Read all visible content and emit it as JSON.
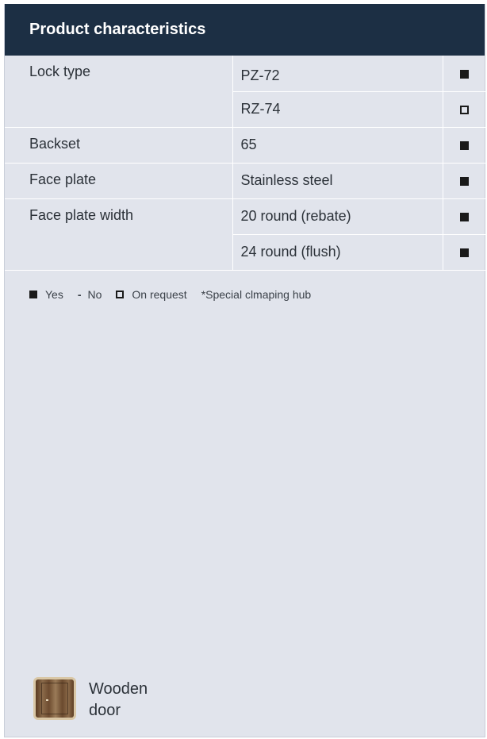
{
  "header": {
    "title": "Product characteristics"
  },
  "rows": [
    {
      "label": "Lock type",
      "value": "PZ-72",
      "symbol": "filled"
    },
    {
      "label": "",
      "value": "RZ-74",
      "symbol": "open"
    },
    {
      "label": "Backset",
      "value": "65",
      "symbol": "filled"
    },
    {
      "label": "Face plate",
      "value": "Stainless steel",
      "symbol": "filled"
    },
    {
      "label": "Face plate width",
      "value": "20 round (rebate)",
      "symbol": "filled"
    },
    {
      "label": "",
      "value": "24 round (flush)",
      "symbol": "filled"
    }
  ],
  "legend": {
    "yes": "Yes",
    "no_symbol": "-",
    "no": "No",
    "on_request": "On request",
    "special": "*Special clmaping hub"
  },
  "door": {
    "label": "Wooden door"
  }
}
